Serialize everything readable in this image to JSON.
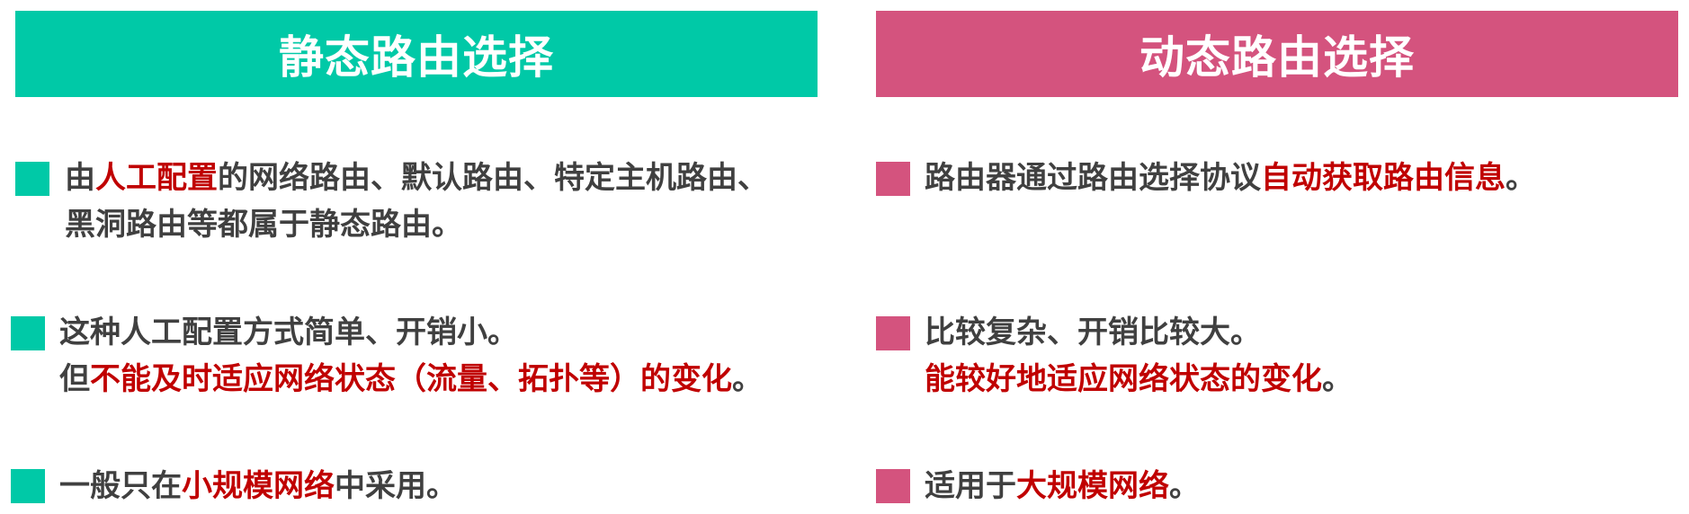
{
  "headers": {
    "static": "静态路由选择",
    "dynamic": "动态路由选择"
  },
  "colors": {
    "static_accent": "#00C9A7",
    "dynamic_accent": "#D4537E",
    "body_text": "#404040",
    "highlight_text": "#C00000"
  },
  "static": {
    "item1": {
      "line1_a": "由",
      "line1_red": "人工配置",
      "line1_b": "的网络路由、默认路由、特定主机路由、",
      "line2": "黑洞路由等都属于静态路由。"
    },
    "item2": {
      "line1": "这种人工配置方式简单、开销小。",
      "line2_a": "但",
      "line2_red": "不能及时适应网络状态（流量、拓扑等）的变化",
      "line2_b": "。"
    },
    "item3": {
      "a": "一般只在",
      "red": "小规模网络",
      "b": "中采用。"
    }
  },
  "dynamic": {
    "item1": {
      "a": "路由器通过路由选择协议",
      "red": "自动获取路由信息",
      "b": "。"
    },
    "item2": {
      "line1": "比较复杂、开销比较大。",
      "line2_red": "能较好地适应网络状态的变化",
      "line2_b": "。"
    },
    "item3": {
      "a": "适用于",
      "red": "大规模网络",
      "b": "。"
    }
  }
}
